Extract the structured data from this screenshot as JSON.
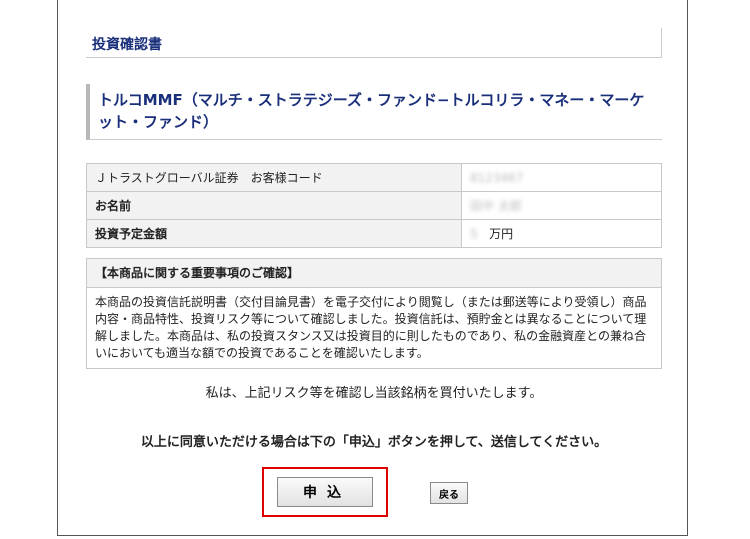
{
  "page_title": "投資確認書",
  "product_title": "トルコMMF（マルチ・ストラテジーズ・ファンド−トルコリラ・マネー・マーケット・ファンド）",
  "info_rows": [
    {
      "label": "Ｊトラストグローバル証券　お客様コード",
      "value": "8123467"
    },
    {
      "label": "お名前",
      "value": "田中 太郎"
    },
    {
      "label": "投資予定金額",
      "amount": "5",
      "unit": "万円"
    }
  ],
  "notice": {
    "heading": "【本商品に関する重要事項のご確認】",
    "body": "本商品の投資信託説明書（交付目論見書）を電子交付により閲覧し（または郵送等により受領し）商品内容・商品特性、投資リスク等について確認しました。投資信託は、預貯金とは異なることについて理解しました。本商品は、私の投資スタンス又は投資目的に則したものであり、私の金融資産との兼ね合いにおいても適当な額での投資であることを確認いたします。"
  },
  "confirm_text": "私は、上記リスク等を確認し当該銘柄を買付いたします。",
  "agree_text": "以上に同意いただける場合は下の「申込」ボタンを押して、送信してください。",
  "buttons": {
    "apply": "申込",
    "back": "戻る"
  },
  "colors": {
    "title": "#1a2f7a",
    "highlight": "#e00000",
    "header_bg": "#f2f2f2"
  }
}
